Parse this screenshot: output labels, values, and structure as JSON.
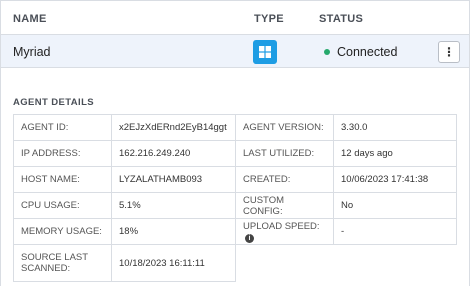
{
  "header": {
    "name": "NAME",
    "type": "TYPE",
    "status": "STATUS"
  },
  "agent_row": {
    "name": "Myriad",
    "type_icon": "windows-icon",
    "status": "Connected",
    "status_color": "#26a96c",
    "type_color": "#1e9de4",
    "more_icon": "vertical-ellipsis-icon",
    "more_glyph": "⋮"
  },
  "details": {
    "title": "AGENT DETAILS",
    "agent_id_label": "AGENT ID:",
    "agent_id": "x2EJzXdERnd2EyB14ggt",
    "agent_version_label": "AGENT VERSION:",
    "agent_version": "3.30.0",
    "ip_label": "IP ADDRESS:",
    "ip": "162.216.249.240",
    "last_utilized_label": "LAST UTILIZED:",
    "last_utilized": "12 days ago",
    "host_label": "HOST NAME:",
    "host": "LYZALATHAMB093",
    "created_label": "CREATED:",
    "created": "10/06/2023 17:41:38",
    "cpu_label": "CPU USAGE:",
    "cpu": "5.1%",
    "custom_config_label": "CUSTOM CONFIG:",
    "custom_config": "No",
    "memory_label": "MEMORY USAGE:",
    "memory": "18%",
    "upload_label": "UPLOAD SPEED:",
    "upload": "-",
    "info_icon": "info-icon",
    "source_label": "SOURCE LAST SCANNED:",
    "source": "10/18/2023 16:11:11"
  }
}
